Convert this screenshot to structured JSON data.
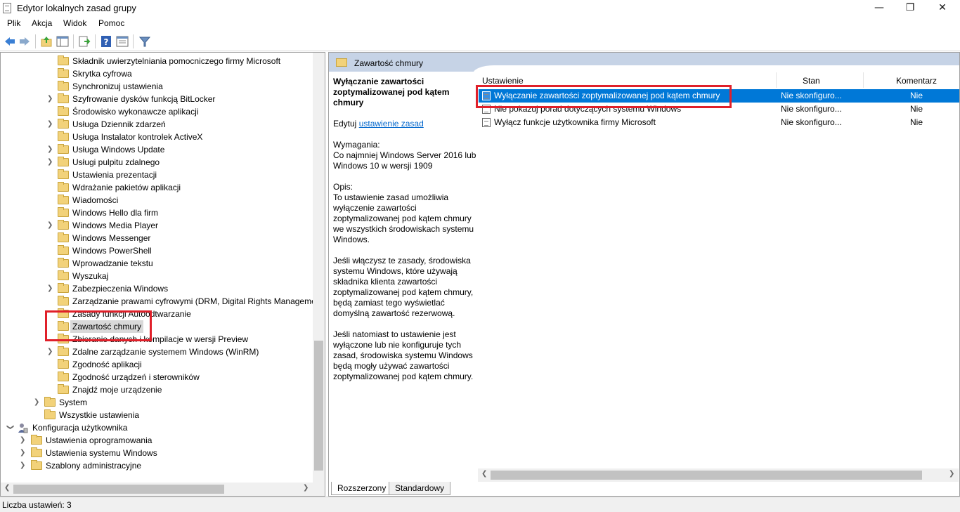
{
  "window": {
    "title": "Edytor lokalnych zasad grupy",
    "minimize": "—",
    "restore": "❐",
    "close": "✕"
  },
  "menu": [
    "Plik",
    "Akcja",
    "Widok",
    "Pomoc"
  ],
  "toolbar_icons": [
    "back-icon",
    "forward-icon",
    "up-folder-icon",
    "show-hide-tree-icon",
    "export-list-icon",
    "help-icon",
    "properties-icon",
    "filter-icon"
  ],
  "tree": {
    "items": [
      {
        "label": "Składnik uwierzytelniania pomocniczego firmy Microsoft",
        "expandable": false
      },
      {
        "label": "Skrytka cyfrowa",
        "expandable": false
      },
      {
        "label": "Synchronizuj ustawienia",
        "expandable": false
      },
      {
        "label": "Szyfrowanie dysków funkcją BitLocker",
        "expandable": true
      },
      {
        "label": "Środowisko wykonawcze aplikacji",
        "expandable": false
      },
      {
        "label": "Usługa Dziennik zdarzeń",
        "expandable": true
      },
      {
        "label": "Usługa Instalator kontrolek ActiveX",
        "expandable": false
      },
      {
        "label": "Usługa Windows Update",
        "expandable": true
      },
      {
        "label": "Usługi pulpitu zdalnego",
        "expandable": true
      },
      {
        "label": "Ustawienia prezentacji",
        "expandable": false
      },
      {
        "label": "Wdrażanie pakietów aplikacji",
        "expandable": false
      },
      {
        "label": "Wiadomości",
        "expandable": false
      },
      {
        "label": "Windows Hello dla firm",
        "expandable": false
      },
      {
        "label": "Windows Media Player",
        "expandable": true
      },
      {
        "label": "Windows Messenger",
        "expandable": false
      },
      {
        "label": "Windows PowerShell",
        "expandable": false
      },
      {
        "label": "Wprowadzanie tekstu",
        "expandable": false
      },
      {
        "label": "Wyszukaj",
        "expandable": false
      },
      {
        "label": "Zabezpieczenia Windows",
        "expandable": true
      },
      {
        "label": "Zarządzanie prawami cyfrowymi (DRM, Digital Rights Manageme",
        "expandable": false
      },
      {
        "label": "Zasady funkcji Autoodtwarzanie",
        "expandable": false
      },
      {
        "label": "Zawartość chmury",
        "expandable": false,
        "selected": true
      },
      {
        "label": "Zbieranie danych i kompilacje w wersji Preview",
        "expandable": false
      },
      {
        "label": "Zdalne zarządzanie systemem Windows (WinRM)",
        "expandable": true
      },
      {
        "label": "Zgodność aplikacji",
        "expandable": false
      },
      {
        "label": "Zgodność urządzeń i sterowników",
        "expandable": false
      },
      {
        "label": "Znajdź moje urządzenie",
        "expandable": false
      }
    ],
    "system": "System",
    "all_settings": "Wszystkie ustawienia",
    "user_config": "Konfiguracja użytkownika",
    "user_children": [
      "Ustawienia oprogramowania",
      "Ustawienia systemu Windows",
      "Szablony administracyjne"
    ]
  },
  "right": {
    "header_title": "Zawartość chmury",
    "desc_title": "Wyłączanie zawartości zoptymalizowanej pod kątem chmury",
    "edit_prefix": "Edytuj",
    "edit_link": "ustawienie zasad",
    "requirements_label": "Wymagania:",
    "requirements_text": "Co najmniej Windows Server 2016 lub Windows 10 w wersji 1909",
    "desc_label": "Opis:",
    "desc_p1": "To ustawienie zasad umożliwia wyłączenie zawartości zoptymalizowanej pod kątem chmury we wszystkich środowiskach systemu Windows.",
    "desc_p2": "Jeśli włączysz te zasady, środowiska systemu Windows, które używają składnika klienta zawartości zoptymalizowanej pod kątem chmury, będą zamiast tego wyświetlać domyślną zawartość rezerwową.",
    "desc_p3": "Jeśli natomiast to ustawienie jest wyłączone lub nie konfiguruje tych zasad, środowiska systemu Windows będą mogły używać zawartości zoptymalizowanej pod kątem chmury.",
    "columns": [
      "Ustawienie",
      "Stan",
      "Komentarz"
    ],
    "rows": [
      {
        "name": "Wyłączanie zawartości zoptymalizowanej pod kątem chmury",
        "state": "Nie skonfiguro...",
        "comment": "Nie"
      },
      {
        "name": "Nie pokazuj porad dotyczących systemu Windows",
        "state": "Nie skonfiguro...",
        "comment": "Nie"
      },
      {
        "name": "Wyłącz funkcje użytkownika firmy Microsoft",
        "state": "Nie skonfiguro...",
        "comment": "Nie"
      }
    ]
  },
  "tabs": [
    "Rozszerzony",
    "Standardowy"
  ],
  "status": "Liczba ustawień: 3",
  "colors": {
    "selection": "#0078d7",
    "highlight_box": "#e0202a",
    "header_band": "#c6d3e6"
  }
}
